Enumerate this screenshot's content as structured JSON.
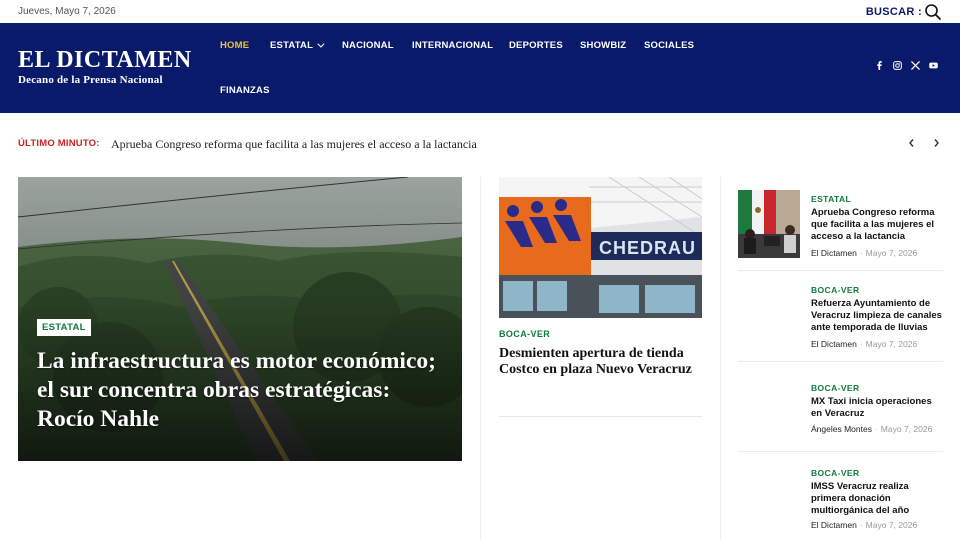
{
  "topbar": {
    "date": "Jueves, Mayo 7, 2026",
    "search_label": "BUSCAR :",
    "search_icon": "search-icon"
  },
  "brand": {
    "name": "EL DICTAMEN",
    "tagline": "Decano de la Prensa Nacional",
    "header_bg": "#0a1a6b",
    "active_color": "#f3c23c",
    "category_color": "#0f7a3d",
    "breaking_color": "#cc2222"
  },
  "nav": {
    "items": [
      {
        "label": "HOME",
        "active": true
      },
      {
        "label": "ESTATAL",
        "dropdown": true
      },
      {
        "label": "NACIONAL"
      },
      {
        "label": "INTERNACIONAL"
      },
      {
        "label": "DEPORTES"
      },
      {
        "label": "SHOWBIZ"
      },
      {
        "label": "SOCIALES"
      },
      {
        "label": "FINANZAS"
      }
    ]
  },
  "social": [
    "facebook-icon",
    "instagram-icon",
    "x-icon",
    "youtube-icon"
  ],
  "breaking": {
    "label": "ÚLTIMO MINUTO:",
    "text": "Aprueba Congreso reforma que facilita a las mujeres el acceso a la lactancia"
  },
  "hero": {
    "category": "ESTATAL",
    "title": "La infraestructura es motor económico; el sur concentra obras estratégicas: Rocío Nahle"
  },
  "middle": {
    "category": "BOCA-VER",
    "title": "Desmienten apertura de tienda Costco en plaza Nuevo Veracruz"
  },
  "sidebar": {
    "items": [
      {
        "category": "ESTATAL",
        "title": "Aprueba Congreso reforma que facilita a las mujeres el acceso a la lactancia",
        "author": "El Dictamen",
        "date": "Mayo 7, 2026"
      },
      {
        "category": "BOCA-VER",
        "title": "Refuerza Ayuntamiento de Veracruz limpieza de canales ante temporada de lluvias",
        "author": "El Dictamen",
        "date": "Mayo 7, 2026"
      },
      {
        "category": "BOCA-VER",
        "title": "MX Taxi inicia operaciones en Veracruz",
        "author": "Ángeles Montes",
        "date": "Mayo 7, 2026"
      },
      {
        "category": "BOCA-VER",
        "title": "IMSS Veracruz realiza primera donación multiorgánica del año",
        "author": "El Dictamen",
        "date": "Mayo 7, 2026"
      }
    ]
  }
}
